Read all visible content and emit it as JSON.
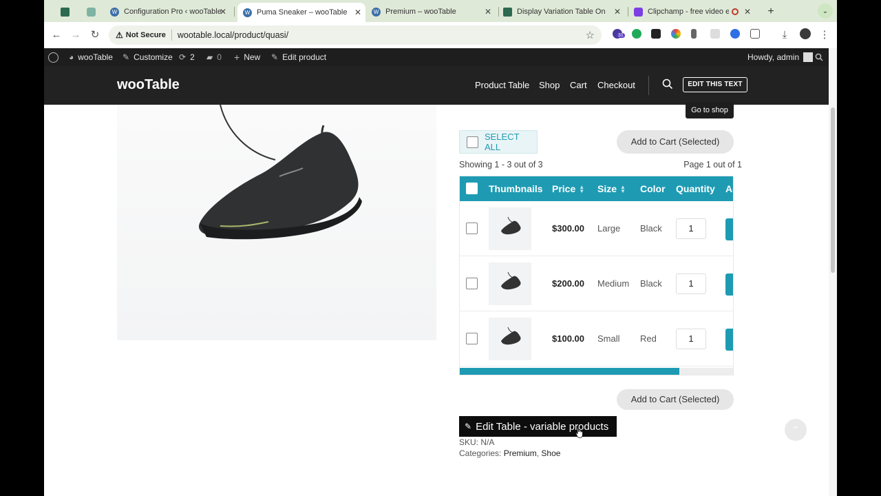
{
  "browser": {
    "tabs": [
      {
        "title": "",
        "active": false
      },
      {
        "title": "",
        "active": false
      },
      {
        "title": "Configuration Pro ‹ wooTable",
        "active": false
      },
      {
        "title": "Puma Sneaker – wooTable",
        "active": true
      },
      {
        "title": "Premium – wooTable",
        "active": false
      },
      {
        "title": "Display Variation Table On Si",
        "active": false
      },
      {
        "title": "Clipchamp - free video ed",
        "active": false
      }
    ],
    "new_tab": "+",
    "security_label": "Not Secure",
    "url": "wootable.local/product/quasi/",
    "extension_badge": "31"
  },
  "adminbar": {
    "site_name": "wooTable",
    "customize": "Customize",
    "updates_count": "2",
    "comments_count": "0",
    "new_label": "New",
    "edit_product": "Edit product",
    "greeting": "Howdy, admin"
  },
  "header": {
    "logo": "wooTable",
    "menu": [
      "Product Table",
      "Shop",
      "Cart",
      "Checkout"
    ],
    "edit_button": "EDIT THIS TEXT",
    "tooltip": "Go to shop"
  },
  "table": {
    "select_all": "SELECT ALL",
    "add_to_cart_selected": "Add to Cart (Selected)",
    "showing": "Showing 1 - 3 out of 3",
    "page_info": "Page 1 out of 1",
    "columns": [
      "Thumbnails",
      "Price",
      "Size",
      "Color",
      "Quantity",
      "Ac"
    ],
    "rows": [
      {
        "price": "$300.00",
        "size": "Large",
        "color": "Black",
        "qty": "1"
      },
      {
        "price": "$200.00",
        "size": "Medium",
        "color": "Black",
        "qty": "1"
      },
      {
        "price": "$100.00",
        "size": "Small",
        "color": "Red",
        "qty": "1"
      }
    ],
    "scroll_position": 0.8
  },
  "edit_table": "Edit Table - variable products",
  "meta": {
    "sku_label": "SKU:",
    "sku_value": "N/A",
    "categories_label": "Categories:",
    "categories": [
      "Premium",
      "Shoe"
    ],
    "separator": ","
  },
  "colors": {
    "accent": "#1e9bb3",
    "admin_bar": "#1e1e1e",
    "header": "#222222"
  }
}
